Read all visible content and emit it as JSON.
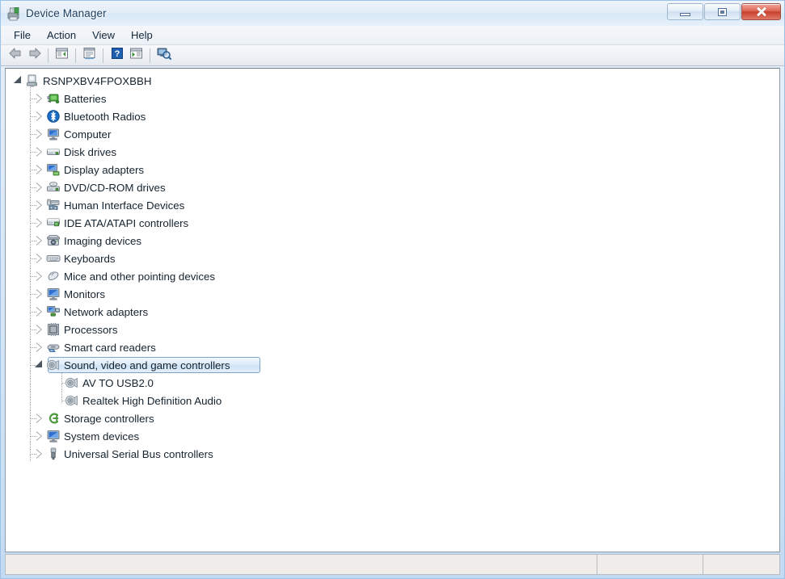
{
  "window": {
    "title": "Device Manager",
    "icon": "device-manager-icon",
    "buttons": {
      "minimize": "Minimize",
      "maximize": "Maximize",
      "close": "Close"
    }
  },
  "menubar": {
    "items": [
      {
        "label": "File"
      },
      {
        "label": "Action"
      },
      {
        "label": "View"
      },
      {
        "label": "Help"
      }
    ]
  },
  "toolbar": {
    "items": [
      {
        "name": "back-arrow-icon",
        "tooltip": "Back"
      },
      {
        "name": "forward-arrow-icon",
        "tooltip": "Forward"
      },
      {
        "name": "separator"
      },
      {
        "name": "show-console-tree-icon",
        "tooltip": "Show/Hide console tree"
      },
      {
        "name": "separator"
      },
      {
        "name": "properties-icon",
        "tooltip": "Properties"
      },
      {
        "name": "separator"
      },
      {
        "name": "help-icon",
        "tooltip": "Help"
      },
      {
        "name": "update-driver-icon",
        "tooltip": "Update Driver Software"
      },
      {
        "name": "separator"
      },
      {
        "name": "scan-hardware-changes-icon",
        "tooltip": "Scan for hardware changes"
      }
    ]
  },
  "tree": {
    "root": {
      "label": "RSNPXBV4FPOXBBH",
      "icon": "computer-root-icon",
      "expanded": true
    },
    "nodes": [
      {
        "label": "Batteries",
        "icon": "battery-icon",
        "expanded": false,
        "selected": false
      },
      {
        "label": "Bluetooth Radios",
        "icon": "bluetooth-icon",
        "expanded": false,
        "selected": false
      },
      {
        "label": "Computer",
        "icon": "computer-icon",
        "expanded": false,
        "selected": false
      },
      {
        "label": "Disk drives",
        "icon": "disk-drive-icon",
        "expanded": false,
        "selected": false
      },
      {
        "label": "Display adapters",
        "icon": "display-adapter-icon",
        "expanded": false,
        "selected": false
      },
      {
        "label": "DVD/CD-ROM drives",
        "icon": "dvd-drive-icon",
        "expanded": false,
        "selected": false
      },
      {
        "label": "Human Interface Devices",
        "icon": "hid-icon",
        "expanded": false,
        "selected": false
      },
      {
        "label": "IDE ATA/ATAPI controllers",
        "icon": "ide-controller-icon",
        "expanded": false,
        "selected": false
      },
      {
        "label": "Imaging devices",
        "icon": "imaging-device-icon",
        "expanded": false,
        "selected": false
      },
      {
        "label": "Keyboards",
        "icon": "keyboard-icon",
        "expanded": false,
        "selected": false
      },
      {
        "label": "Mice and other pointing devices",
        "icon": "mouse-icon",
        "expanded": false,
        "selected": false
      },
      {
        "label": "Monitors",
        "icon": "monitor-icon",
        "expanded": false,
        "selected": false
      },
      {
        "label": "Network adapters",
        "icon": "network-adapter-icon",
        "expanded": false,
        "selected": false
      },
      {
        "label": "Processors",
        "icon": "processor-icon",
        "expanded": false,
        "selected": false
      },
      {
        "label": "Smart card readers",
        "icon": "smart-card-reader-icon",
        "expanded": false,
        "selected": false
      },
      {
        "label": "Sound, video and game controllers",
        "icon": "sound-controller-icon",
        "expanded": true,
        "selected": true,
        "children": [
          {
            "label": "AV TO USB2.0",
            "icon": "sound-device-icon"
          },
          {
            "label": "Realtek High Definition Audio",
            "icon": "sound-device-icon"
          }
        ]
      },
      {
        "label": "Storage controllers",
        "icon": "storage-controller-icon",
        "expanded": false,
        "selected": false
      },
      {
        "label": "System devices",
        "icon": "system-device-icon",
        "expanded": false,
        "selected": false
      },
      {
        "label": "Universal Serial Bus controllers",
        "icon": "usb-controller-icon",
        "expanded": false,
        "selected": false
      }
    ]
  },
  "statusbar": {
    "pane1": "",
    "pane2": "",
    "pane3": ""
  },
  "colors": {
    "selection_border": "#7da2ce",
    "selection_fill": "#dceaf8",
    "close_button": "#c6402d",
    "frame": "#b9d4ef"
  }
}
